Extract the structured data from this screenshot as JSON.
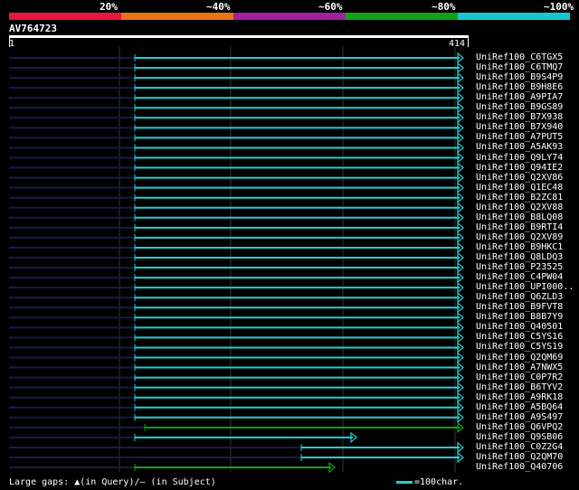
{
  "legend": {
    "segments": [
      {
        "color": "#e8163c",
        "label": "20%"
      },
      {
        "color": "#e87414",
        "label": "~40%"
      },
      {
        "color": "#a020a0",
        "label": "~60%"
      },
      {
        "color": "#16a016",
        "label": "~80%"
      },
      {
        "color": "#18c8d0",
        "label": "~100%"
      }
    ]
  },
  "query": {
    "name": "AV764723",
    "start": "1",
    "end": "414"
  },
  "hits": [
    {
      "name": "UniRef100_C6TGX5",
      "color": "#22d0d4"
    },
    {
      "name": "UniRef100_C6TMQ7",
      "color": "#22d0d4"
    },
    {
      "name": "UniRef100_B9S4P9",
      "color": "#22d0d4"
    },
    {
      "name": "UniRef100_B9H8E6",
      "color": "#22d0d4"
    },
    {
      "name": "UniRef100_A9PIA7",
      "color": "#22d0d4"
    },
    {
      "name": "UniRef100_B9GS89",
      "color": "#22d0d4"
    },
    {
      "name": "UniRef100_B7X938",
      "color": "#22d0d4"
    },
    {
      "name": "UniRef100_B7X940",
      "color": "#22d0d4"
    },
    {
      "name": "UniRef100_A7PUT5",
      "color": "#22d0d4"
    },
    {
      "name": "UniRef100_A5AK93",
      "color": "#22d0d4"
    },
    {
      "name": "UniRef100_Q9LY74",
      "color": "#22d0d4"
    },
    {
      "name": "UniRef100_Q94IE2",
      "color": "#22d0d4"
    },
    {
      "name": "UniRef100_Q2XV86",
      "color": "#22d0d4"
    },
    {
      "name": "UniRef100_Q1EC48",
      "color": "#22d0d4"
    },
    {
      "name": "UniRef100_B2ZC81",
      "color": "#22d0d4"
    },
    {
      "name": "UniRef100_Q2XV88",
      "color": "#22d0d4"
    },
    {
      "name": "UniRef100_B8LQ08",
      "color": "#22d0d4"
    },
    {
      "name": "UniRef100_B9RTI4",
      "color": "#22d0d4"
    },
    {
      "name": "UniRef100_Q2XV89",
      "color": "#22d0d4"
    },
    {
      "name": "UniRef100_B9HKC1",
      "color": "#22d0d4"
    },
    {
      "name": "UniRef100_Q8LDQ3",
      "color": "#22d0d4"
    },
    {
      "name": "UniRef100_P23525",
      "color": "#22d0d4"
    },
    {
      "name": "UniRef100_C4PW04",
      "color": "#22d0d4"
    },
    {
      "name": "UniRef100_UPI000..",
      "color": "#22d0d4"
    },
    {
      "name": "UniRef100_Q6ZLD3",
      "color": "#22d0d4"
    },
    {
      "name": "UniRef100_B9FVT8",
      "color": "#22d0d4"
    },
    {
      "name": "UniRef100_B8B7Y9",
      "color": "#22d0d4"
    },
    {
      "name": "UniRef100_Q40501",
      "color": "#22d0d4"
    },
    {
      "name": "UniRef100_C5YS16",
      "color": "#22d0d4"
    },
    {
      "name": "UniRef100_C5YS19",
      "color": "#22d0d4"
    },
    {
      "name": "UniRef100_Q2QM69",
      "color": "#22d0d4"
    },
    {
      "name": "UniRef100_A7NWX5",
      "color": "#22d0d4"
    },
    {
      "name": "UniRef100_C0P7R2",
      "color": "#22d0d4"
    },
    {
      "name": "UniRef100_B6TYV2",
      "color": "#22d0d4"
    },
    {
      "name": "UniRef100_A9RK18",
      "color": "#22d0d4"
    },
    {
      "name": "UniRef100_A5BQ64",
      "color": "#22d0d4"
    },
    {
      "name": "UniRef100_A9S497",
      "color": "#22d0d4"
    },
    {
      "name": "UniRef100_Q6VPQ2",
      "color": "#16a016"
    },
    {
      "name": "UniRef100_Q9SB06",
      "color": "#22d0d4"
    },
    {
      "name": "UniRef100_C0Z2G4",
      "color": "#22d0d4"
    },
    {
      "name": "UniRef100_Q2QM70",
      "color": "#22d0d4"
    },
    {
      "name": "UniRef100_Q40706",
      "color": "#16a016"
    }
  ],
  "footer": {
    "text": "Large gaps: ▲(in Query)/— (in Subject)",
    "scale_key": "=100char."
  }
}
